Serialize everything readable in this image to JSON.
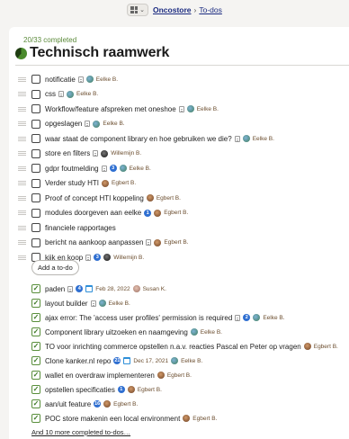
{
  "header": {
    "breadcrumb_project": "Oncostore",
    "breadcrumb_separator": "›",
    "breadcrumb_current": "To-dos"
  },
  "list": {
    "progress_text": "20/33 completed",
    "progress_fraction": 0.606,
    "title": "Technisch raamwerk",
    "add_button_label": "Add a to-do",
    "more_completed_link": "And 10 more completed to-dos…",
    "colors": {
      "progress": "#4a8a2c",
      "check": "#3e7a26",
      "link": "#1a2a80"
    }
  },
  "open_todos": [
    {
      "text": "notificatie",
      "doc": true,
      "count": "",
      "date": "",
      "assignee": "Eelke B.",
      "avatar": "eelke"
    },
    {
      "text": "css",
      "doc": true,
      "count": "",
      "date": "",
      "assignee": "Eelke B.",
      "avatar": "eelke"
    },
    {
      "text": "Workflow/feature afspreken met oneshoe",
      "doc": true,
      "count": "",
      "date": "",
      "assignee": "Eelke B.",
      "avatar": "eelke"
    },
    {
      "text": "opgeslagen",
      "doc": true,
      "count": "",
      "date": "",
      "assignee": "Eelke B.",
      "avatar": "eelke"
    },
    {
      "text": "waar staat de component library en hoe gebruiken we die?",
      "doc": true,
      "count": "",
      "date": "",
      "assignee": "Eelke B.",
      "avatar": "eelke"
    },
    {
      "text": "store en filters",
      "doc": true,
      "count": "",
      "date": "",
      "assignee": "Willemijn B.",
      "avatar": "willemijn"
    },
    {
      "text": "gdpr foutmelding",
      "doc": true,
      "count": "3",
      "date": "",
      "assignee": "Eelke B.",
      "avatar": "eelke"
    },
    {
      "text": "Verder study HTI",
      "doc": false,
      "count": "",
      "date": "",
      "assignee": "Egbert B.",
      "avatar": "egbert"
    },
    {
      "text": "Proof of concept HTI koppeling",
      "doc": false,
      "count": "",
      "date": "",
      "assignee": "Egbert B.",
      "avatar": "egbert"
    },
    {
      "text": "modules doorgeven aan eelke",
      "doc": false,
      "count": "1",
      "date": "",
      "assignee": "Egbert B.",
      "avatar": "egbert"
    },
    {
      "text": "financiele rapportages",
      "doc": false,
      "count": "",
      "date": "",
      "assignee": "",
      "avatar": ""
    },
    {
      "text": "bericht na aankoop aanpassen",
      "doc": true,
      "count": "",
      "date": "",
      "assignee": "Egbert B.",
      "avatar": "egbert"
    },
    {
      "text": "kijk en koop",
      "doc": true,
      "count": "3",
      "date": "",
      "assignee": "Willemijn B.",
      "avatar": "willemijn"
    }
  ],
  "completed_todos": [
    {
      "text": "paden",
      "doc": true,
      "count": "4",
      "date": "Feb 28, 2022",
      "assignee": "Susan K.",
      "avatar": "susan"
    },
    {
      "text": "layout builder",
      "doc": true,
      "count": "",
      "date": "",
      "assignee": "Eelke B.",
      "avatar": "eelke"
    },
    {
      "text": "ajax error: The 'access user profiles' permission is required",
      "doc": true,
      "count": "2",
      "date": "",
      "assignee": "Eelke B.",
      "avatar": "eelke"
    },
    {
      "text": "Component library uitzoeken en naamgeving",
      "doc": false,
      "count": "",
      "date": "",
      "assignee": "Eelke B.",
      "avatar": "eelke"
    },
    {
      "text": "TO voor inrichting commerce opstellen n.a.v. reacties Pascal en Peter op vragen",
      "doc": false,
      "count": "",
      "date": "",
      "assignee": "Egbert B.",
      "avatar": "egbert"
    },
    {
      "text": "Clone kanker.nl repo",
      "doc": false,
      "count": "21",
      "date": "Dec 17, 2021",
      "assignee": "Eelke B.",
      "avatar": "eelke"
    },
    {
      "text": "wallet en overdraw implementeren",
      "doc": false,
      "count": "",
      "date": "",
      "assignee": "Egbert B.",
      "avatar": "egbert"
    },
    {
      "text": "opstellen specificaties",
      "doc": false,
      "count": "1",
      "date": "",
      "assignee": "Egbert B.",
      "avatar": "egbert"
    },
    {
      "text": "aan/uit feature",
      "doc": false,
      "count": "16",
      "date": "",
      "assignee": "Egbert B.",
      "avatar": "egbert"
    },
    {
      "text": "POC store makenin een local environment",
      "doc": false,
      "count": "",
      "date": "",
      "assignee": "Egbert B.",
      "avatar": "egbert"
    }
  ]
}
